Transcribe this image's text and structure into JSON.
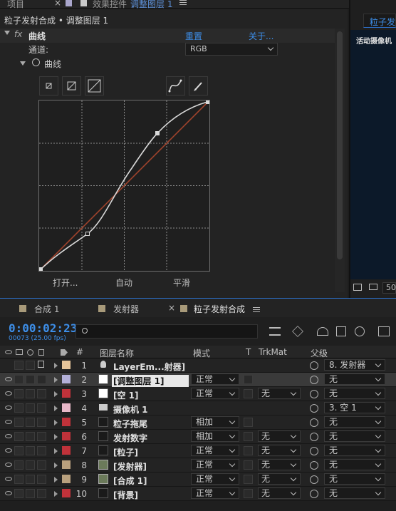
{
  "top_tabs": {
    "project": "项目",
    "effect_controls_prefix": "效果控件",
    "effect_controls_layer": "调整图层 1"
  },
  "effect_panel": {
    "comp_title": "粒子发射合成 • 调整图层 1",
    "effect_name": "曲线",
    "fx_label": "fx",
    "reset": "重置",
    "about": "关于...",
    "channel_label": "通道:",
    "channel_value": "RGB",
    "curves_label": "曲线",
    "buttons": {
      "open": "打开...",
      "auto": "自动",
      "smooth": "平滑"
    }
  },
  "right_panel": {
    "tab": "粒子发",
    "camera_text": "活动摄像机",
    "zoom": "50"
  },
  "timeline": {
    "tabs": [
      {
        "label": "合成",
        "num": "1"
      },
      {
        "label": "发射器",
        "num": ""
      },
      {
        "label": "粒子发射合成",
        "num": ""
      }
    ],
    "timecode": "0:00:02:23",
    "fps": "00073 (25.00 fps)",
    "search_placeholder": "",
    "columns": {
      "num": "#",
      "name": "图层名称",
      "mode": "模式",
      "t": "T",
      "trkmat": "TrkMat",
      "parent": "父级"
    },
    "layers": [
      {
        "num": "1",
        "name": "LayerEm...射器]",
        "label_color": "#e5c49a",
        "mode": "",
        "trk": "",
        "parent": "8. 发射器",
        "icon": "light"
      },
      {
        "num": "2",
        "name": "[调整图层 1]",
        "label_color": "#b3b0d8",
        "mode": "正常",
        "trk": "",
        "parent": "无",
        "icon": "solid-white"
      },
      {
        "num": "3",
        "name": "[空 1]",
        "label_color": "#c0323a",
        "mode": "正常",
        "trk": "无",
        "parent": "无",
        "icon": "solid-white"
      },
      {
        "num": "4",
        "name": "摄像机 1",
        "label_color": "#e8b8c8",
        "mode": "",
        "trk": "",
        "parent": "3. 空 1",
        "icon": "camera"
      },
      {
        "num": "5",
        "name": "粒子拖尾",
        "label_color": "#c0323a",
        "mode": "相加",
        "trk": "",
        "parent": "无",
        "icon": "solid-dark"
      },
      {
        "num": "6",
        "name": "发射数字",
        "label_color": "#c0323a",
        "mode": "相加",
        "trk": "无",
        "parent": "无",
        "icon": "solid-dark"
      },
      {
        "num": "7",
        "name": "[粒子]",
        "label_color": "#c0323a",
        "mode": "正常",
        "trk": "无",
        "parent": "无",
        "icon": "solid-dark"
      },
      {
        "num": "8",
        "name": "[发射器]",
        "label_color": "#b8a07e",
        "mode": "正常",
        "trk": "无",
        "parent": "无",
        "icon": "comp"
      },
      {
        "num": "9",
        "name": "[合成 1]",
        "label_color": "#b8a07e",
        "mode": "正常",
        "trk": "无",
        "parent": "无",
        "icon": "comp"
      },
      {
        "num": "10",
        "name": "[背景]",
        "label_color": "#c0323a",
        "mode": "正常",
        "trk": "无",
        "parent": "无",
        "icon": "solid-dark"
      }
    ]
  },
  "colors": {
    "accent_blue": "#3d8ee8",
    "curve_white": "#d8d8d8",
    "curve_diag": "#a0432c",
    "timeline_border": "#2c6fc9"
  }
}
